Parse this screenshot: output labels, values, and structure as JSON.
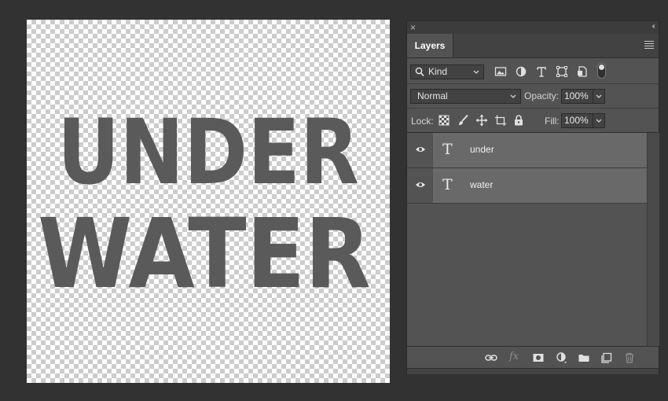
{
  "canvas": {
    "line1": "UNDER",
    "line2": "WATER",
    "text_color": "#5a5a5a"
  },
  "panel": {
    "close_glyph": "×",
    "collapse_glyph": "‹‹",
    "tab_label": "Layers",
    "filter": {
      "kind_label": "Kind",
      "icons": [
        "image-filter-icon",
        "adjustment-filter-icon",
        "type-filter-icon",
        "shape-filter-icon",
        "smart-object-filter-icon"
      ]
    },
    "blend": {
      "mode": "Normal",
      "opacity_label": "Opacity:",
      "opacity_value": "100%"
    },
    "lock": {
      "label": "Lock:",
      "fill_label": "Fill:",
      "fill_value": "100%"
    },
    "layers": [
      {
        "name": "under",
        "type_glyph": "T",
        "visible": true
      },
      {
        "name": "water",
        "type_glyph": "T",
        "visible": true
      }
    ],
    "bottom_icons": [
      "link-layers-icon",
      "fx-icon",
      "mask-icon",
      "adjustment-layer-icon",
      "group-folder-icon",
      "new-layer-icon",
      "trash-icon"
    ],
    "fx_label": "fx"
  },
  "colors": {
    "app_background": "#323232",
    "panel_background": "#535353",
    "layer_row": "#696969"
  }
}
